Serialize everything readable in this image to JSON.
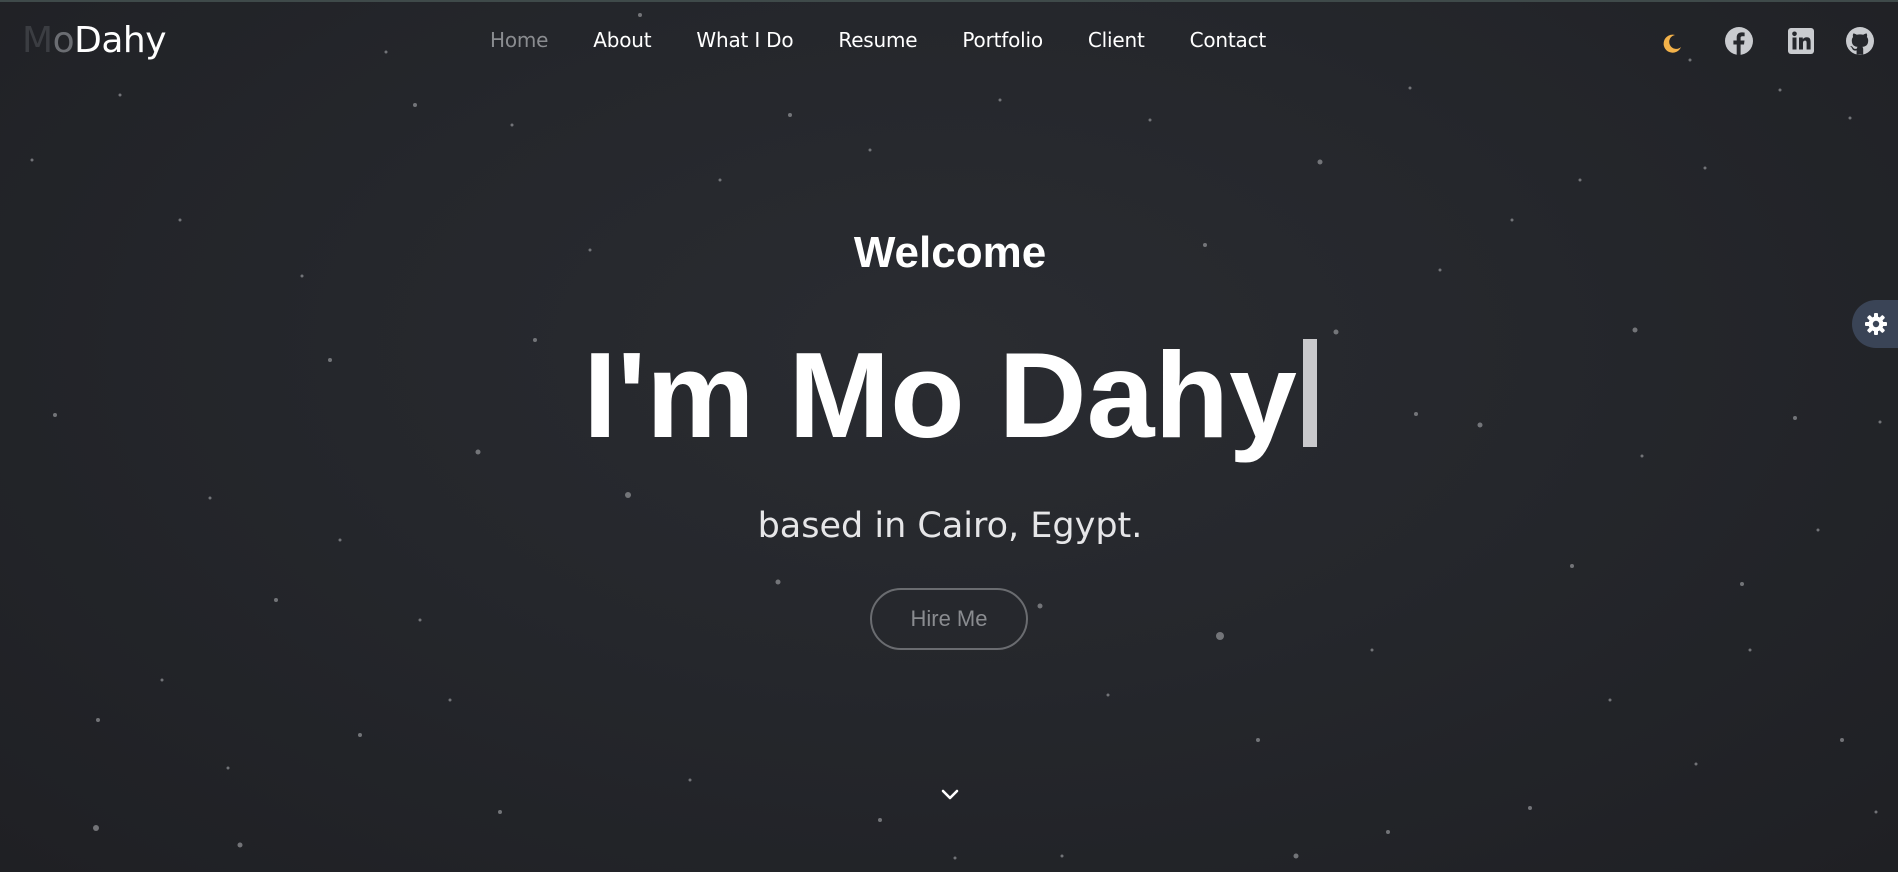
{
  "logo": {
    "part1": "M",
    "part2": "o",
    "part3": "Dahy"
  },
  "nav": {
    "items": [
      {
        "label": "Home",
        "active": true
      },
      {
        "label": "About",
        "active": false
      },
      {
        "label": "What I Do",
        "active": false
      },
      {
        "label": "Resume",
        "active": false
      },
      {
        "label": "Portfolio",
        "active": false
      },
      {
        "label": "Client",
        "active": false
      },
      {
        "label": "Contact",
        "active": false
      }
    ]
  },
  "header_icons": [
    "moon-icon",
    "facebook-icon",
    "linkedin-icon",
    "github-icon"
  ],
  "hero": {
    "welcome": "Welcome",
    "headline": "I'm Mo Dahy",
    "subtitle": "based in Cairo, Egypt.",
    "cta_label": "Hire Me"
  },
  "colors": {
    "background": "#24262b",
    "text": "#ffffff",
    "muted": "#8a8c90",
    "moon": "#f3b24a",
    "gear_tab": "#3a4456"
  }
}
